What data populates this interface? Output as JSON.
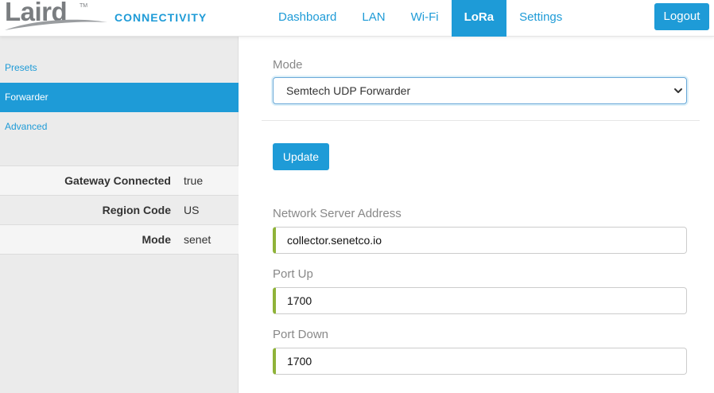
{
  "header": {
    "logo_text": "Laird",
    "logo_tm": "TM",
    "brand": "CONNECTIVITY",
    "nav": [
      {
        "label": "Dashboard"
      },
      {
        "label": "LAN"
      },
      {
        "label": "Wi-Fi"
      },
      {
        "label": "LoRa",
        "active": true
      },
      {
        "label": "Settings"
      }
    ],
    "logout_label": "Logout"
  },
  "sidebar": {
    "menu": [
      {
        "label": "Presets"
      },
      {
        "label": "Forwarder",
        "active": true
      },
      {
        "label": "Advanced"
      }
    ],
    "status": [
      {
        "label": "Gateway Connected",
        "value": "true"
      },
      {
        "label": "Region Code",
        "value": "US"
      },
      {
        "label": "Mode",
        "value": "senet"
      }
    ]
  },
  "main": {
    "mode_label": "Mode",
    "mode_value": "Semtech UDP Forwarder",
    "update_label": "Update",
    "server_label": "Network Server Address",
    "server_value": "collector.senetco.io",
    "port_up_label": "Port Up",
    "port_up_value": "1700",
    "port_down_label": "Port Down",
    "port_down_value": "1700"
  },
  "colors": {
    "accent": "#1e9bd7",
    "logo_gray": "#7a7d80",
    "input_valid_border": "#8fb339",
    "sidebar_bg": "#ebebeb"
  }
}
